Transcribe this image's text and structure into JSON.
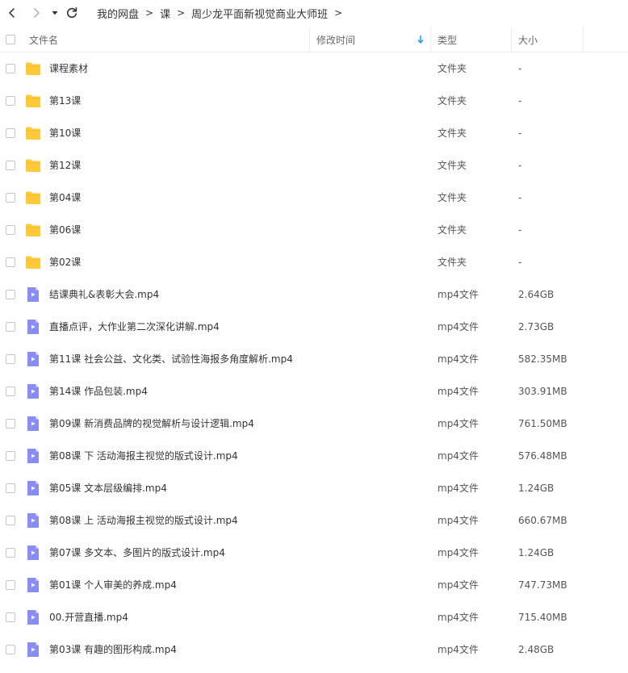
{
  "nav": {
    "back_icon": "chevron-left-icon",
    "forward_icon": "chevron-right-icon",
    "history_icon": "caret-down-icon",
    "refresh_icon": "refresh-icon"
  },
  "breadcrumb": {
    "items": [
      "我的网盘",
      "课",
      "周少龙平面新视觉商业大师班"
    ],
    "separator": ">"
  },
  "header": {
    "name": "文件名",
    "modified": "修改时间",
    "type": "类型",
    "size": "大小"
  },
  "colors": {
    "folder": "#ffc93a",
    "video": "#8a8cf5",
    "sort_arrow": "#1a9af0"
  },
  "files": [
    {
      "name": "课程素材",
      "type": "文件夹",
      "size": "-",
      "kind": "folder"
    },
    {
      "name": "第13课",
      "type": "文件夹",
      "size": "-",
      "kind": "folder"
    },
    {
      "name": "第10课",
      "type": "文件夹",
      "size": "-",
      "kind": "folder"
    },
    {
      "name": "第12课",
      "type": "文件夹",
      "size": "-",
      "kind": "folder"
    },
    {
      "name": "第04课",
      "type": "文件夹",
      "size": "-",
      "kind": "folder"
    },
    {
      "name": "第06课",
      "type": "文件夹",
      "size": "-",
      "kind": "folder"
    },
    {
      "name": "第02课",
      "type": "文件夹",
      "size": "-",
      "kind": "folder"
    },
    {
      "name": "结课典礼&表彰大会.mp4",
      "type": "mp4文件",
      "size": "2.64GB",
      "kind": "video"
    },
    {
      "name": "直播点评，大作业第二次深化讲解.mp4",
      "type": "mp4文件",
      "size": "2.73GB",
      "kind": "video"
    },
    {
      "name": "第11课 社会公益、文化类、试验性海报多角度解析.mp4",
      "type": "mp4文件",
      "size": "582.35MB",
      "kind": "video"
    },
    {
      "name": "第14课 作品包装.mp4",
      "type": "mp4文件",
      "size": "303.91MB",
      "kind": "video"
    },
    {
      "name": "第09课 新消费品牌的视觉解析与设计逻辑.mp4",
      "type": "mp4文件",
      "size": "761.50MB",
      "kind": "video"
    },
    {
      "name": "第08课 下 活动海报主视觉的版式设计.mp4",
      "type": "mp4文件",
      "size": "576.48MB",
      "kind": "video"
    },
    {
      "name": "第05课 文本层级编排.mp4",
      "type": "mp4文件",
      "size": "1.24GB",
      "kind": "video"
    },
    {
      "name": "第08课 上 活动海报主视觉的版式设计.mp4",
      "type": "mp4文件",
      "size": "660.67MB",
      "kind": "video"
    },
    {
      "name": "第07课 多文本、多图片的版式设计.mp4",
      "type": "mp4文件",
      "size": "1.24GB",
      "kind": "video"
    },
    {
      "name": "第01课 个人审美的养成.mp4",
      "type": "mp4文件",
      "size": "747.73MB",
      "kind": "video"
    },
    {
      "name": "00.开营直播.mp4",
      "type": "mp4文件",
      "size": "715.40MB",
      "kind": "video"
    },
    {
      "name": "第03课 有趣的图形构成.mp4",
      "type": "mp4文件",
      "size": "2.48GB",
      "kind": "video"
    }
  ]
}
